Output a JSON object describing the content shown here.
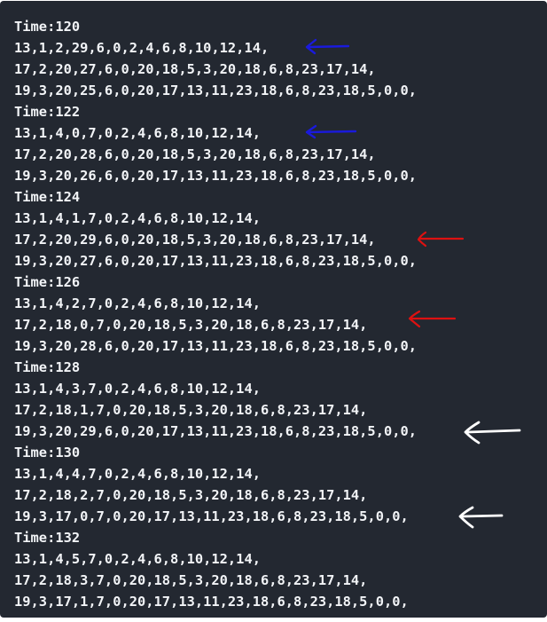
{
  "code_block": {
    "lines": [
      "Time:120",
      "13,1,2,29,6,0,2,4,6,8,10,12,14,",
      "17,2,20,27,6,0,20,18,5,3,20,18,6,8,23,17,14,",
      "19,3,20,25,6,0,20,17,13,11,23,18,6,8,23,18,5,0,0,",
      "Time:122",
      "13,1,4,0,7,0,2,4,6,8,10,12,14,",
      "17,2,20,28,6,0,20,18,5,3,20,18,6,8,23,17,14,",
      "19,3,20,26,6,0,20,17,13,11,23,18,6,8,23,18,5,0,0,",
      "Time:124",
      "13,1,4,1,7,0,2,4,6,8,10,12,14,",
      "17,2,20,29,6,0,20,18,5,3,20,18,6,8,23,17,14,",
      "19,3,20,27,6,0,20,17,13,11,23,18,6,8,23,18,5,0,0,",
      "Time:126",
      "13,1,4,2,7,0,2,4,6,8,10,12,14,",
      "17,2,18,0,7,0,20,18,5,3,20,18,6,8,23,17,14,",
      "19,3,20,28,6,0,20,17,13,11,23,18,6,8,23,18,5,0,0,",
      "Time:128",
      "13,1,4,3,7,0,2,4,6,8,10,12,14,",
      "17,2,18,1,7,0,20,18,5,3,20,18,6,8,23,17,14,",
      "19,3,20,29,6,0,20,17,13,11,23,18,6,8,23,18,5,0,0,",
      "Time:130",
      "13,1,4,4,7,0,2,4,6,8,10,12,14,",
      "17,2,18,2,7,0,20,18,5,3,20,18,6,8,23,17,14,",
      "19,3,17,0,7,0,20,17,13,11,23,18,6,8,23,18,5,0,0,",
      "Time:132",
      "13,1,4,5,7,0,2,4,6,8,10,12,14,",
      "17,2,18,3,7,0,20,18,5,3,20,18,6,8,23,17,14,",
      "19,3,17,1,7,0,20,17,13,11,23,18,6,8,23,18,5,0,0,"
    ]
  },
  "annotations": {
    "arrow_colors": {
      "blue": "#1a1adc",
      "red": "#dd1111",
      "white": "#ffffff"
    },
    "arrows": [
      {
        "name": "blue-arrow-1",
        "color": "blue",
        "direction": "left"
      },
      {
        "name": "blue-arrow-2",
        "color": "blue",
        "direction": "left"
      },
      {
        "name": "red-arrow-1",
        "color": "red",
        "direction": "left"
      },
      {
        "name": "red-arrow-2",
        "color": "red",
        "direction": "left"
      },
      {
        "name": "white-arrow-1",
        "color": "white",
        "direction": "left"
      },
      {
        "name": "white-arrow-2",
        "color": "white",
        "direction": "left"
      }
    ]
  },
  "colors": {
    "code_background": "#232831",
    "code_text": "#f2f4f7",
    "page_background": "#ffffff"
  }
}
